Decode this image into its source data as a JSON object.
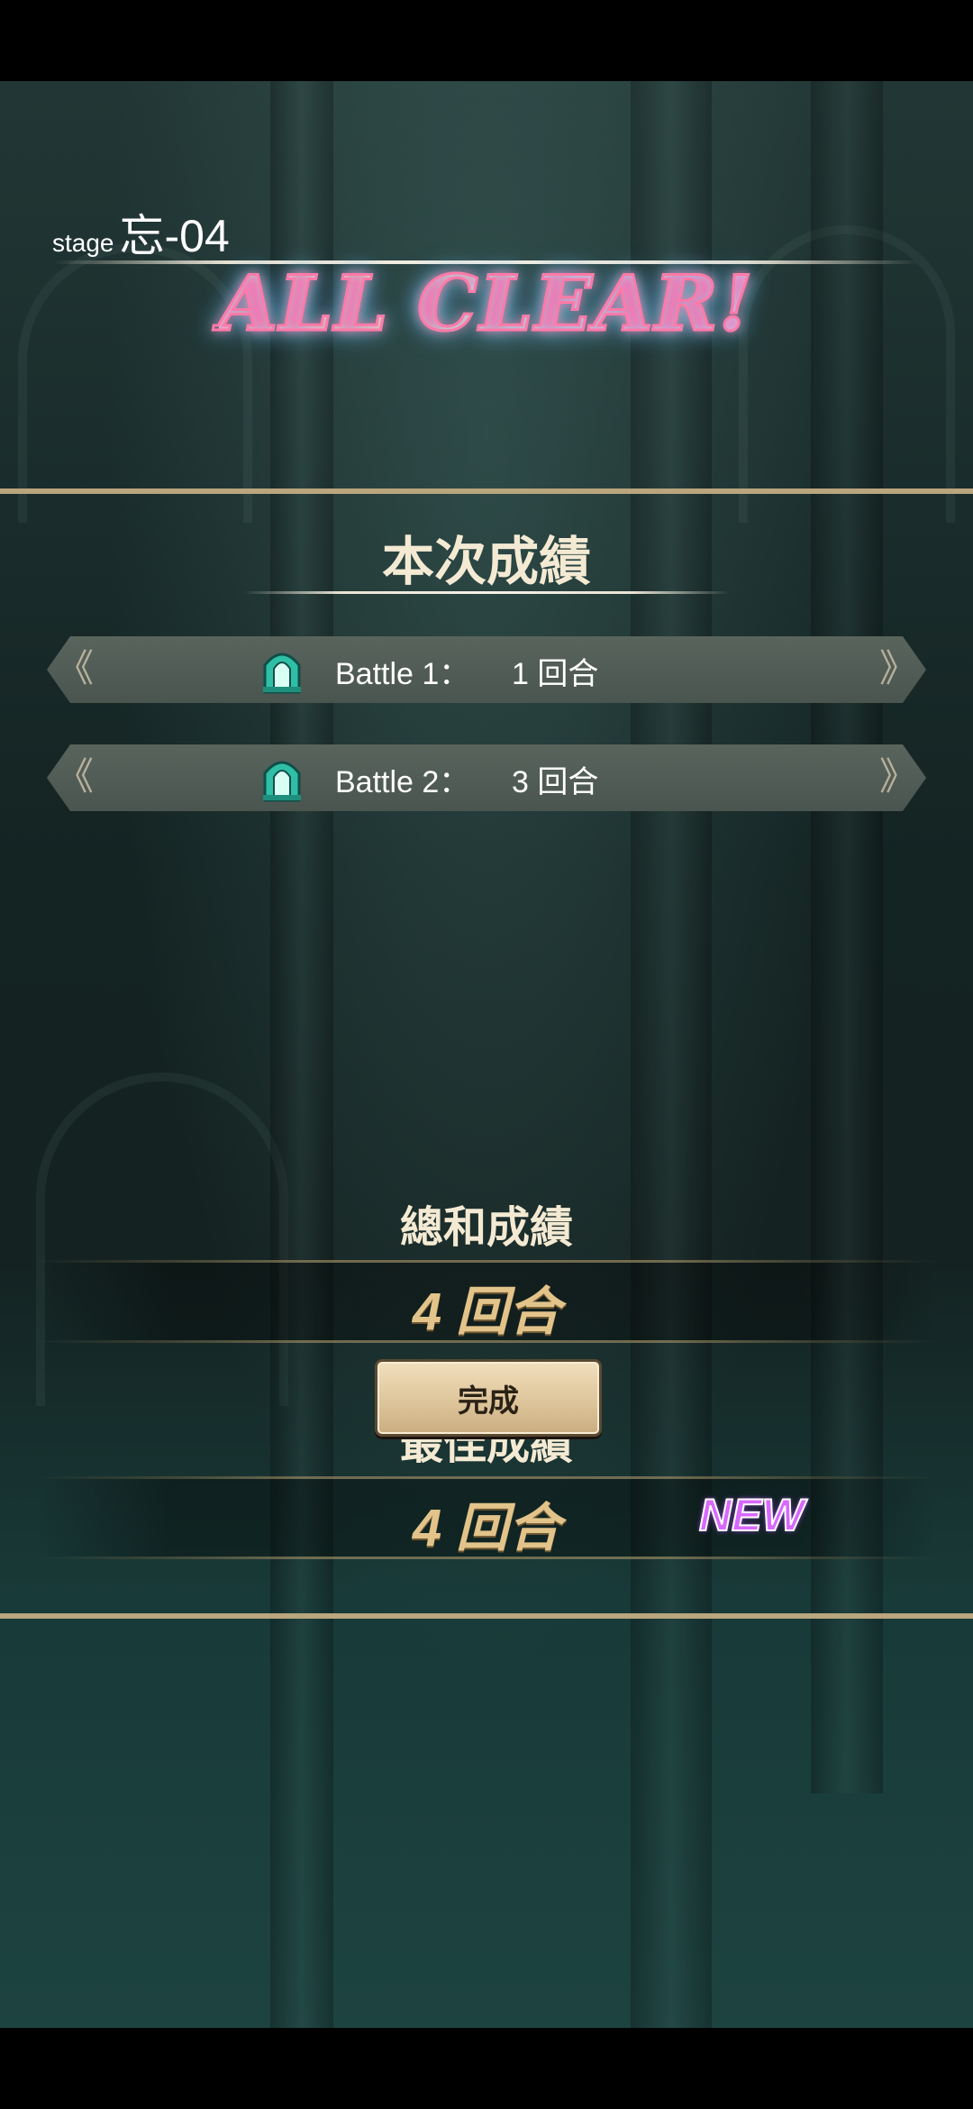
{
  "stage": {
    "prefix": "stage",
    "name": "忘-04"
  },
  "banner": {
    "text": "ALL CLEAR!"
  },
  "current_result": {
    "title": "本次成績",
    "battles": [
      {
        "label": "Battle 1：",
        "value": "1 回合",
        "icon": "tower-icon"
      },
      {
        "label": "Battle 2：",
        "value": "3 回合",
        "icon": "tower-icon"
      }
    ]
  },
  "total_result": {
    "title": "總和成績",
    "value": "4 回合"
  },
  "best_result": {
    "title": "最佳成績",
    "value": "4 回合",
    "badge": "NEW"
  },
  "done_button": {
    "label": "完成"
  },
  "colors": {
    "gold_line": "#b9a57e",
    "score_text": "#e2c38a",
    "new_badge": "#d968ff",
    "button_bg": "#dcc398"
  }
}
